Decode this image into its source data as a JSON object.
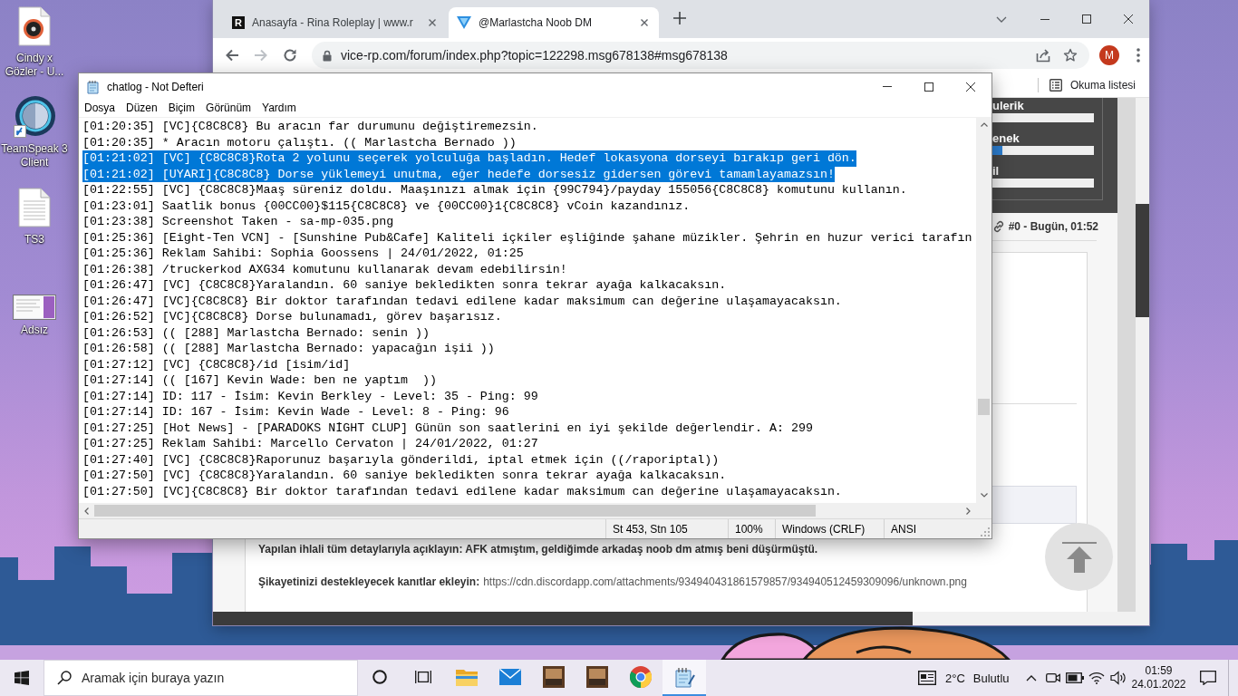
{
  "desktop": {
    "icons": [
      {
        "label": "Cindy x Gözler - U...",
        "kind": "music",
        "shortcut": false
      },
      {
        "label": "TeamSpeak 3 Client",
        "kind": "ring",
        "shortcut": true
      },
      {
        "label": "TS3",
        "kind": "text",
        "shortcut": false
      },
      {
        "label": "Adsız",
        "kind": "image",
        "shortcut": false
      }
    ]
  },
  "browser": {
    "tabs": [
      {
        "title": "Anasayfa - Rina Roleplay | www.r",
        "favicon": "R",
        "selected": false
      },
      {
        "title": "@Marlastcha Noob DM",
        "selected": true
      }
    ],
    "nav": {
      "back_disabled": false,
      "forward_disabled": true
    },
    "address": "vice-rp.com/forum/index.php?topic=122298.msg678138#msg678138",
    "profile_initial": "M",
    "reading_list": "Okuma listesi",
    "page": {
      "stats": [
        {
          "label": "ulerik",
          "level": 0
        },
        {
          "label": "enek",
          "level": 0.1
        },
        {
          "label": "il",
          "level": 0
        }
      ],
      "post_meta": "#0 - Bugün, 01:52",
      "fields": [
        {
          "kind": "text",
          "label": "Yapılan ihlali tüm detaylarıyla açıklayın:",
          "value": "AFK atmıştım, geldiğimde arkadaş noob dm atmış beni düşürmüştü."
        },
        {
          "kind": "link",
          "label": "Şikayetinizi destekleyecek kanıtlar ekleyin:",
          "value": "https://cdn.discordapp.com/attachments/934940431861579857/934940512459309096/unknown.png"
        }
      ]
    }
  },
  "notepad": {
    "title": "chatlog - Not Defteri",
    "menu": [
      "Dosya",
      "Düzen",
      "Biçim",
      "Görünüm",
      "Yardım"
    ],
    "lines": [
      {
        "text": "[01:20:35] [VC]{C8C8C8} Bu aracın far durumunu değiştiremezsin.",
        "selected": false
      },
      {
        "text": "[01:20:35] * Aracın motoru çalıştı. (( Marlastcha Bernado ))",
        "selected": false
      },
      {
        "text": "[01:21:02] [VC] {C8C8C8}Rota 2 yolunu seçerek yolculuğa başladın. Hedef lokasyona dorseyi bırakıp geri dön.",
        "selected": true
      },
      {
        "text": "[01:21:02] [UYARI]{C8C8C8} Dorse yüklemeyi unutma, eğer hedefe dorsesiz gidersen görevi tamamlayamazsın!",
        "selected": true
      },
      {
        "text": "[01:22:55] [VC] {C8C8C8}Maaş süreniz doldu. Maaşınızı almak için {99C794}/payday 155056{C8C8C8} komutunu kullanın.",
        "selected": false
      },
      {
        "text": "[01:23:01] Saatlik bonus {00CC00}$115{C8C8C8} ve {00CC00}1{C8C8C8} vCoin kazandınız.",
        "selected": false
      },
      {
        "text": "[01:23:38] Screenshot Taken - sa-mp-035.png",
        "selected": false
      },
      {
        "text": "[01:25:36] [Eight-Ten VCN] - [Sunshine Pub&Cafe] Kaliteli içkiler eşliğinde şahane müzikler. Şehrin en huzur verici tarafın",
        "selected": false
      },
      {
        "text": "[01:25:36] Reklam Sahibi: Sophia Goossens | 24/01/2022, 01:25",
        "selected": false
      },
      {
        "text": "[01:26:38] /truckerkod AXG34 komutunu kullanarak devam edebilirsin!",
        "selected": false
      },
      {
        "text": "[01:26:47] [VC] {C8C8C8}Yaralandın. 60 saniye bekledikten sonra tekrar ayağa kalkacaksın.",
        "selected": false
      },
      {
        "text": "[01:26:47] [VC]{C8C8C8} Bir doktor tarafından tedavi edilene kadar maksimum can değerine ulaşamayacaksın.",
        "selected": false
      },
      {
        "text": "[01:26:52] [VC]{C8C8C8} Dorse bulunamadı, görev başarısız.",
        "selected": false
      },
      {
        "text": "[01:26:53] (( [288] Marlastcha Bernado: senin ))",
        "selected": false
      },
      {
        "text": "[01:26:58] (( [288] Marlastcha Bernado: yapacağın işii ))",
        "selected": false
      },
      {
        "text": "[01:27:12] [VC] {C8C8C8}/id [isim/id]",
        "selected": false
      },
      {
        "text": "[01:27:14] (( [167] Kevin Wade: ben ne yaptım  ))",
        "selected": false
      },
      {
        "text": "[01:27:14] ID: 117 - İsim: Kevin Berkley - Level: 35 - Ping: 99",
        "selected": false
      },
      {
        "text": "[01:27:14] ID: 167 - İsim: Kevin Wade - Level: 8 - Ping: 96",
        "selected": false
      },
      {
        "text": "[01:27:25] [Hot News] - [PARADOKS NİGHT CLUP] Günün son saatlerini en iyi şekilde değerlendir. A: 299",
        "selected": false
      },
      {
        "text": "[01:27:25] Reklam Sahibi: Marcello Cervaton | 24/01/2022, 01:27",
        "selected": false
      },
      {
        "text": "[01:27:40] [VC] {C8C8C8}Raporunuz başarıyla gönderildi, iptal etmek için ((/raporiptal))",
        "selected": false
      },
      {
        "text": "[01:27:50] [VC] {C8C8C8}Yaralandın. 60 saniye bekledikten sonra tekrar ayağa kalkacaksın.",
        "selected": false
      },
      {
        "text": "[01:27:50] [VC]{C8C8C8} Bir doktor tarafından tedavi edilene kadar maksimum can değerine ulaşamayacaksın.",
        "selected": false
      }
    ],
    "status": [
      "St 453, Stn 105",
      "100%",
      "Windows (CRLF)",
      "ANSI"
    ]
  },
  "taskbar": {
    "search": {
      "placeholder": "Aramak için buraya yazın"
    },
    "apps": [
      {
        "kind": "explorer",
        "active": false
      },
      {
        "kind": "mail",
        "active": false
      },
      {
        "kind": "game",
        "active": false
      },
      {
        "kind": "game",
        "active": false
      },
      {
        "kind": "chrome",
        "active": false
      },
      {
        "kind": "notepad",
        "active": true
      }
    ],
    "weather": {
      "temperature": "2°C",
      "condition": "Bulutlu"
    },
    "clock": {
      "time": "01:59",
      "date": "24.01.2022"
    }
  }
}
